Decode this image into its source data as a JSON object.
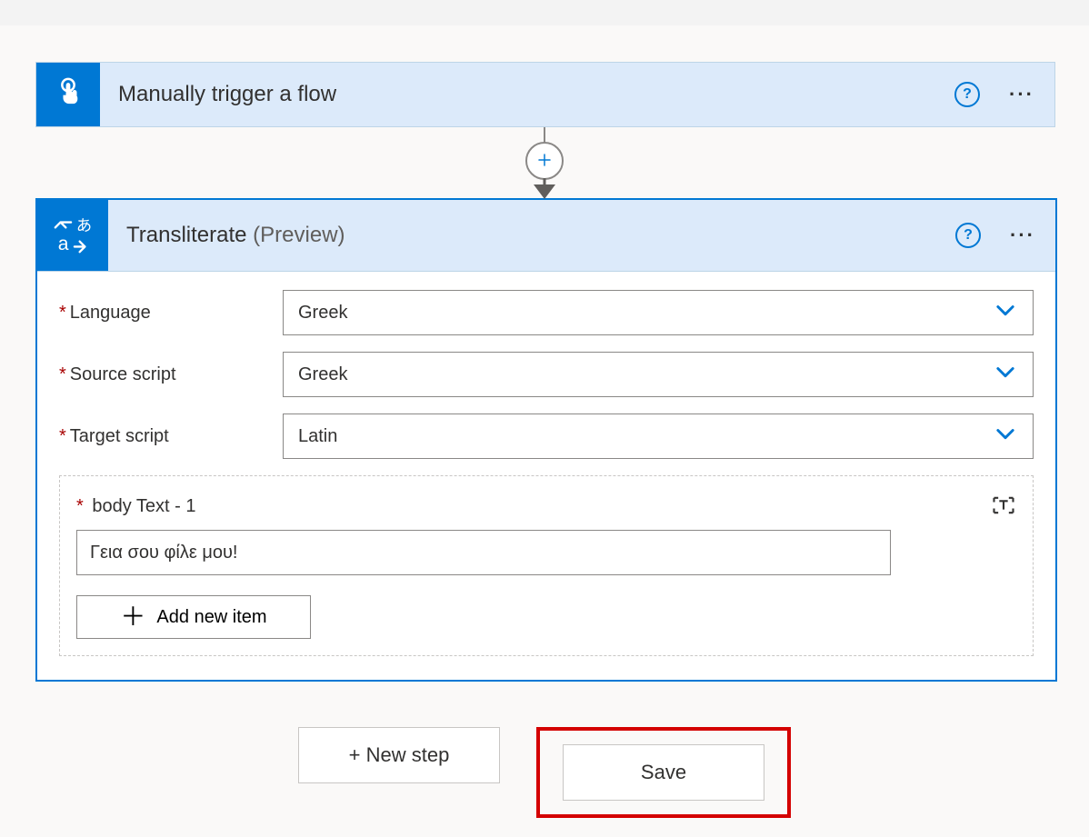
{
  "trigger": {
    "title": "Manually trigger a flow"
  },
  "action": {
    "title": "Transliterate",
    "badge": "(Preview)",
    "fields": {
      "language": {
        "label": "Language",
        "value": "Greek"
      },
      "source_script": {
        "label": "Source script",
        "value": "Greek"
      },
      "target_script": {
        "label": "Target script",
        "value": "Latin"
      }
    },
    "array": {
      "label": "body Text - 1",
      "value": "Γεια σου φίλε μου!",
      "add_label": "Add new item"
    }
  },
  "footer": {
    "new_step": "+ New step",
    "save": "Save"
  }
}
